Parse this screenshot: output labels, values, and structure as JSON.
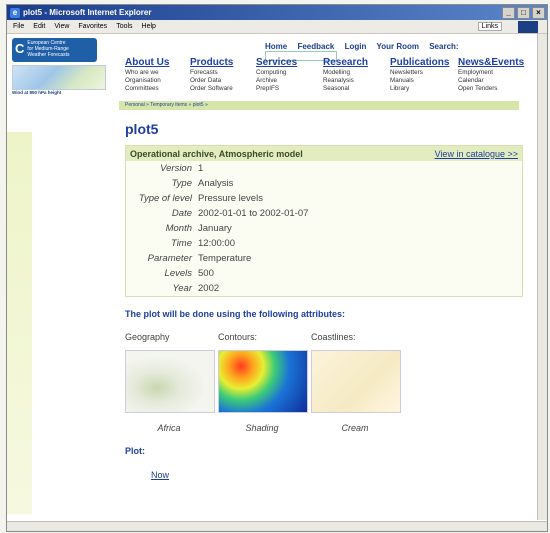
{
  "window": {
    "title": "plot5 - Microsoft Internet Explorer",
    "menu": [
      "File",
      "Edit",
      "View",
      "Favorites",
      "Tools",
      "Help"
    ],
    "links_label": "Links"
  },
  "site": {
    "logo_lines": [
      "European Centre",
      "for Medium-Range",
      "Weather Forecasts"
    ],
    "map_caption": "Wind at 850 hPa height",
    "top_nav": [
      "Home",
      "Feedback",
      "Login",
      "Your Room",
      "Search:"
    ],
    "nav_columns": [
      {
        "head": "About Us",
        "items": [
          "Who are we",
          "Organisation",
          "Committees"
        ]
      },
      {
        "head": "Products",
        "items": [
          "Forecasts",
          "Order Data",
          "Order Software"
        ]
      },
      {
        "head": "Services",
        "items": [
          "Computing",
          "Archive",
          "PrepIFS"
        ]
      },
      {
        "head": "Research",
        "items": [
          "Modelling",
          "Reanalysis",
          "Seasonal"
        ]
      },
      {
        "head": "Publications",
        "items": [
          "Newsletters",
          "Manuals",
          "Library"
        ]
      },
      {
        "head": "News&Events",
        "items": [
          "Employment",
          "Calendar",
          "Open Tenders"
        ]
      }
    ],
    "breadcrumb": "Personal » Temporary items » plot5 »"
  },
  "page": {
    "title": "plot5",
    "panel_title": "Operational archive, Atmospheric model",
    "catalogue_link": "View in catalogue >>",
    "params": [
      {
        "k": "Version",
        "v": "1"
      },
      {
        "k": "Type",
        "v": "Analysis"
      },
      {
        "k": "Type of level",
        "v": "Pressure levels"
      },
      {
        "k": "Date",
        "v": "2002-01-01 to 2002-01-07"
      },
      {
        "k": "Month",
        "v": "January"
      },
      {
        "k": "Time",
        "v": "12:00:00"
      },
      {
        "k": "Parameter",
        "v": "Temperature"
      },
      {
        "k": "Levels",
        "v": "500"
      },
      {
        "k": "Year",
        "v": "2002"
      }
    ],
    "attrs_title": "The plot will be done using the following attributes:",
    "attributes": [
      {
        "label": "Geography",
        "caption": "Africa"
      },
      {
        "label": "Contours:",
        "caption": "Shading"
      },
      {
        "label": "Coastlines:",
        "caption": "Cream"
      }
    ],
    "plot_label": "Plot:",
    "now_link": "Now"
  }
}
